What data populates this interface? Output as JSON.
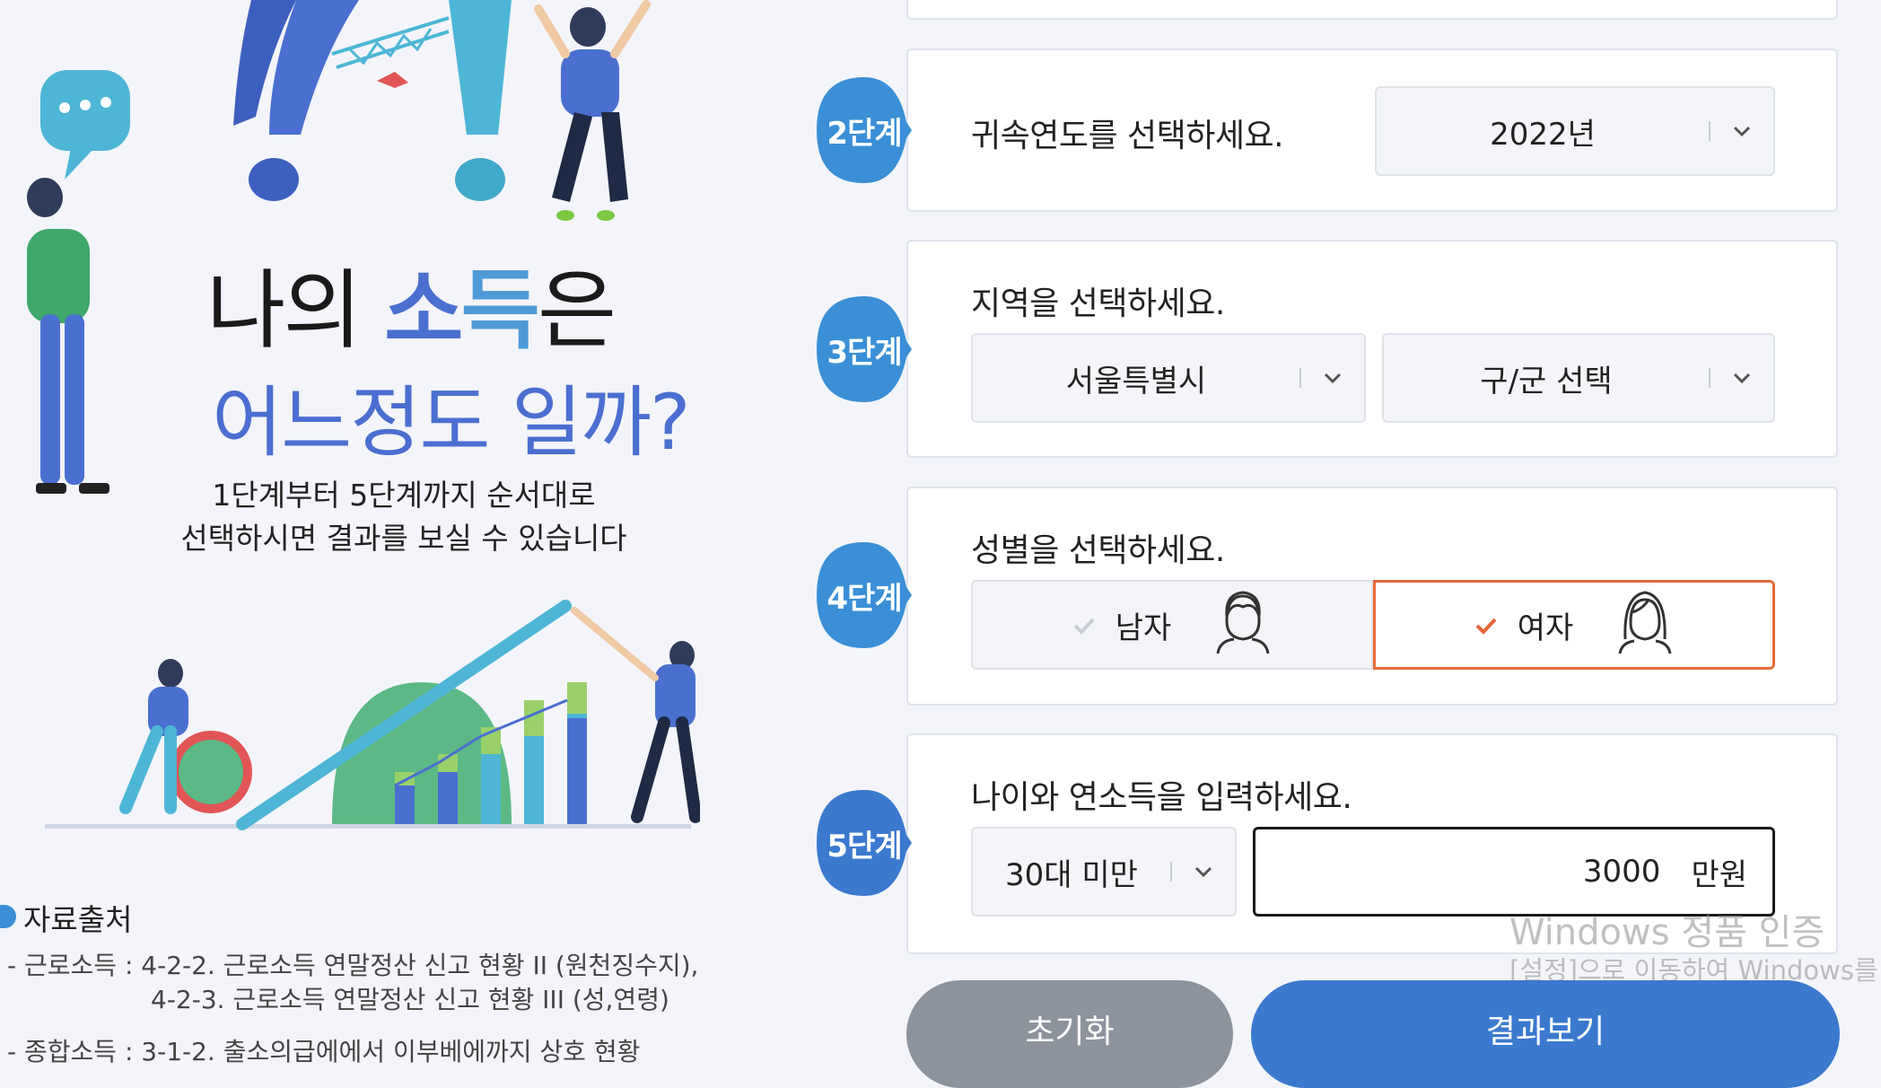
{
  "left": {
    "title_line1_plain": "나의 ",
    "title_line1_accent1": "소",
    "title_line1_accent2": "득",
    "title_line1_end": "은",
    "title_line2": "어느정도 일까?",
    "desc_line1": "1단계부터 5단계까지 순서대로",
    "desc_line2": "선택하시면 결과를 보실 수 있습니다",
    "source_title": "자료출처",
    "source_lines": [
      "- 근로소득 :  4-2-2. 근로소득 연말정산 신고 현황 II (원천징수지),",
      "4-2-3. 근로소득 연말정산 신고 현황 III (성,연령)",
      "- 종합소득 :  3-1-2. 출소의급에에서 이부베에까지 상호 현황"
    ]
  },
  "steps": {
    "step2": {
      "badge": "2단계",
      "question": "귀속연도를 선택하세요.",
      "year_value": "2022년"
    },
    "step3": {
      "badge": "3단계",
      "question": "지역을 선택하세요.",
      "city_value": "서울특별시",
      "district_value": "구/군 선택"
    },
    "step4": {
      "badge": "4단계",
      "question": "성별을 선택하세요.",
      "male_label": "남자",
      "female_label": "여자",
      "selected": "여자"
    },
    "step5": {
      "badge": "5단계",
      "question": "나이와 연소득을 입력하세요.",
      "age_value": "30대 미만",
      "income_value": "3000",
      "income_unit": "만원"
    }
  },
  "buttons": {
    "reset_label": "초기화",
    "result_label": "결과보기"
  },
  "watermark": {
    "line1": "Windows 정품 인증",
    "line2": "[설정]으로 이동하여 Windows를"
  },
  "colors": {
    "badge_blue": "#3a8fd6",
    "badge_blue_dark": "#3b79cf",
    "accent_title": "#4a6fd0",
    "selected_border": "#e46b3a",
    "check_orange": "#e8643a",
    "reset_btn": "#8d939c",
    "result_btn": "#3b79cf"
  },
  "icons": {
    "chat_bubble": "chat-bubble-icon",
    "chevron": "chevron-down-icon",
    "check": "check-icon",
    "male_avatar": "male-avatar-icon",
    "female_avatar": "female-avatar-icon"
  }
}
